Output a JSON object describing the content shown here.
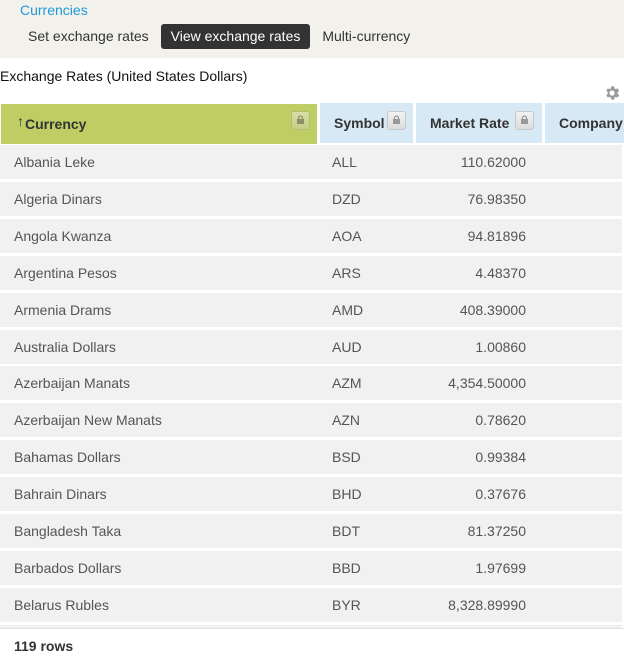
{
  "breadcrumb": {
    "label": "Currencies"
  },
  "tabs": [
    {
      "label": "Set exchange rates",
      "active": false
    },
    {
      "label": "View exchange rates",
      "active": true
    },
    {
      "label": "Multi-currency",
      "active": false
    }
  ],
  "section": {
    "title": "Exchange Rates (United States Dollars)",
    "settings_icon": "gear-icon"
  },
  "table": {
    "columns": [
      {
        "label": "Currency",
        "sorted": "ascending",
        "sort_icon": "arrow-up-icon",
        "lock_icon": "lock-icon"
      },
      {
        "label": "Symbol",
        "lock_icon": "lock-icon"
      },
      {
        "label": "Market Rate",
        "lock_icon": "lock-icon"
      },
      {
        "label": "Company"
      }
    ],
    "rows": [
      {
        "currency": "Albania Leke",
        "symbol": "ALL",
        "market_rate": "110.62000"
      },
      {
        "currency": "Algeria Dinars",
        "symbol": "DZD",
        "market_rate": "76.98350"
      },
      {
        "currency": "Angola Kwanza",
        "symbol": "AOA",
        "market_rate": "94.81896"
      },
      {
        "currency": "Argentina Pesos",
        "symbol": "ARS",
        "market_rate": "4.48370"
      },
      {
        "currency": "Armenia Drams",
        "symbol": "AMD",
        "market_rate": "408.39000"
      },
      {
        "currency": "Australia Dollars",
        "symbol": "AUD",
        "market_rate": "1.00860"
      },
      {
        "currency": "Azerbaijan Manats",
        "symbol": "AZM",
        "market_rate": "4,354.50000"
      },
      {
        "currency": "Azerbaijan New Manats",
        "symbol": "AZN",
        "market_rate": "0.78620"
      },
      {
        "currency": "Bahamas Dollars",
        "symbol": "BSD",
        "market_rate": "0.99384"
      },
      {
        "currency": "Bahrain Dinars",
        "symbol": "BHD",
        "market_rate": "0.37676"
      },
      {
        "currency": "Bangladesh Taka",
        "symbol": "BDT",
        "market_rate": "81.37250"
      },
      {
        "currency": "Barbados Dollars",
        "symbol": "BBD",
        "market_rate": "1.97699"
      },
      {
        "currency": "Belarus Rubles",
        "symbol": "BYR",
        "market_rate": "8,328.89990"
      },
      {
        "currency": "",
        "symbol": "",
        "market_rate": ""
      }
    ]
  },
  "footer": {
    "row_count": "119 rows"
  }
}
